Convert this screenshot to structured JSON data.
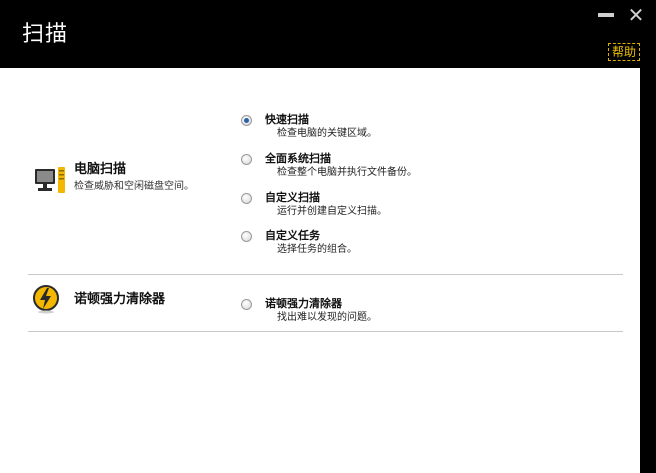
{
  "window": {
    "title": "扫描",
    "minimize_label": "",
    "close_label": "✕",
    "help_label": "帮助"
  },
  "sections": [
    {
      "icon": "computer-icon",
      "title": "电脑扫描",
      "description": "检查威胁和空闲磁盘空间。",
      "options": [
        {
          "label": "快速扫描",
          "description": "检查电脑的关键区域。",
          "selected": true
        },
        {
          "label": "全面系统扫描",
          "description": "检查整个电脑并执行文件备份。",
          "selected": false
        },
        {
          "label": "自定义扫描",
          "description": "运行并创建自定义扫描。",
          "selected": false
        },
        {
          "label": "自定义任务",
          "description": "选择任务的组合。",
          "selected": false
        }
      ]
    },
    {
      "icon": "power-eraser-icon",
      "title": "诺顿强力清除器",
      "description": "",
      "options": [
        {
          "label": "诺顿强力清除器",
          "description": "找出难以发现的问题。",
          "selected": false
        }
      ]
    }
  ],
  "colors": {
    "titlebar_bg": "#000000",
    "help_link": "#f0c000",
    "radio_selected": "#2f5fa8",
    "icon_yellow": "#f5b800"
  }
}
